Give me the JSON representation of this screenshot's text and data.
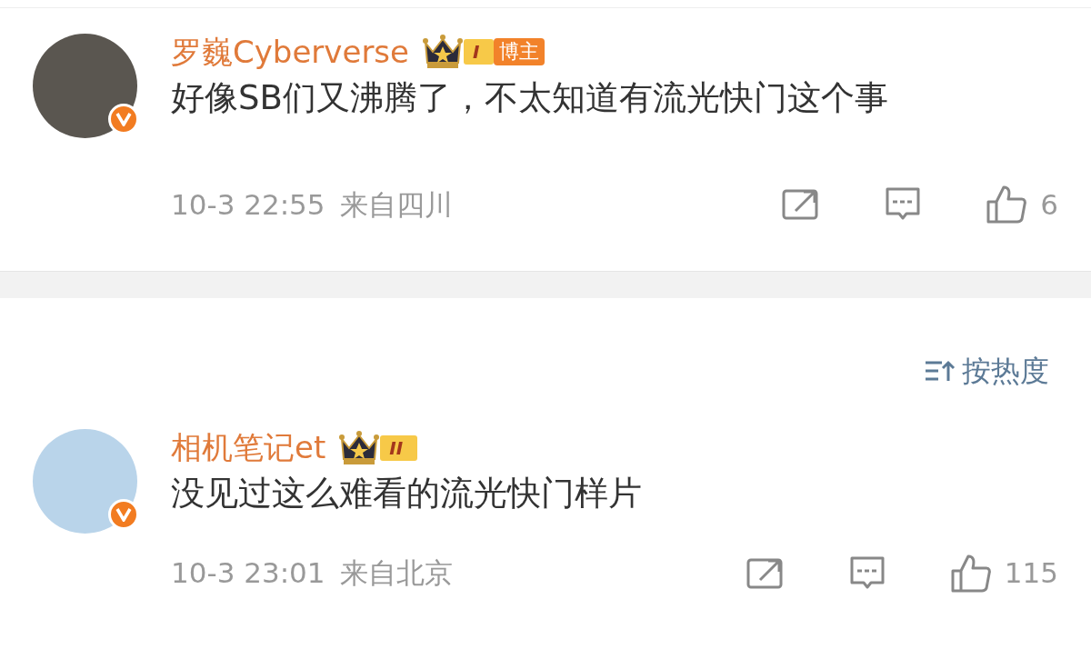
{
  "post": {
    "author": "罗巍Cyberverse",
    "verified": true,
    "level": "I",
    "tag": "博主",
    "text": "好像SB们又沸腾了，不太知道有流光快门这个事",
    "time": "10-3 22:55",
    "location": "来自四川",
    "likes": "6"
  },
  "sort": {
    "label": "按热度"
  },
  "comments": [
    {
      "author": "相机笔记et",
      "verified": true,
      "level": "II",
      "text": "没见过这么难看的流光快门样片",
      "time": "10-3 23:01",
      "location": "来自北京",
      "likes": "115"
    }
  ]
}
